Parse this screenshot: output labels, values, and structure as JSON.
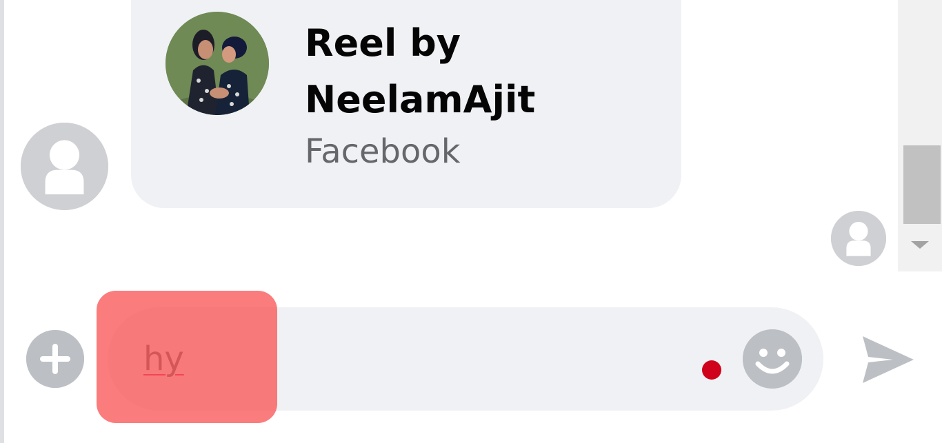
{
  "shared_post": {
    "title": "Reel by NeelamAjit",
    "source": "Facebook",
    "thumbnail_icon": "reel-thumbnail-image"
  },
  "avatars": {
    "sender_icon": "default-user-avatar-icon",
    "seen_icon": "default-user-avatar-icon"
  },
  "composer": {
    "value": "hy",
    "plus_icon": "plus-circle-icon",
    "emoji_icon": "smiley-icon",
    "send_icon": "send-arrow-icon",
    "typing_indicator_color": "#d0021b"
  },
  "scrollbar": {
    "down_icon": "scroll-down-arrow-icon"
  },
  "colors": {
    "bubble": "#f0f1f5",
    "icon_gray": "#bcc0c4",
    "highlight": "#fa5050"
  }
}
